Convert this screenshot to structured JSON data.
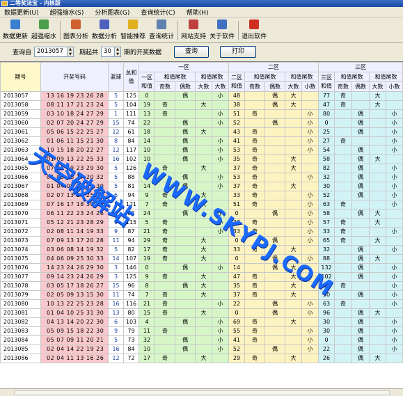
{
  "window": {
    "title": "二等奖法宝 - 内核版"
  },
  "menu": [
    "数据更新(U)",
    "超强缩水(S)",
    "分析图表(G)",
    "查询统计(C)",
    "帮助(H)"
  ],
  "toolbar": [
    {
      "label": "数据更新",
      "icon": "refresh-icon",
      "color": "#3a7fd0"
    },
    {
      "label": "超强缩水",
      "icon": "shrink-icon",
      "color": "#4aa04a"
    },
    {
      "label": "图表分析",
      "icon": "chart-icon",
      "color": "#d06030"
    },
    {
      "label": "数据分析",
      "icon": "gear-icon",
      "color": "#5060c0"
    },
    {
      "label": "智能推荐",
      "icon": "bulb-icon",
      "color": "#e0b020"
    },
    {
      "label": "查询统计",
      "icon": "search-icon",
      "color": "#6080b0"
    },
    {
      "label": "网站支持",
      "icon": "home-icon",
      "color": "#c04040"
    },
    {
      "label": "关于软件",
      "icon": "info-icon",
      "color": "#4070c0"
    },
    {
      "label": "退出软件",
      "icon": "exit-icon",
      "color": "#d03020"
    }
  ],
  "query": {
    "issue_label": "查询自",
    "issue_value": "2013057",
    "period_label": "期起共",
    "period_value": "30",
    "period_suffix": "期的开奖数据",
    "query_button": "查询",
    "print_button": "打印"
  },
  "table": {
    "head_issue": "期号",
    "head_numbers": "开奖号码",
    "head_blue": "蓝球",
    "head_total": "总和值",
    "zone1": "一区",
    "zone2": "二区",
    "zone3": "三区",
    "z1_sum": "一区和值",
    "z2_sum": "二区和值",
    "z3_sum": "三区和值",
    "tail_sum": "和值尾数",
    "tail_sum_parity": "和值尾数",
    "tail_sum_size": "和值尾数",
    "odd": "奇数",
    "even": "偶数",
    "big": "大数",
    "small": "小数",
    "rows": [
      [
        "2013057",
        "13 16 19 23 26 28",
        "5",
        "125",
        "0",
        "",
        "偶",
        "",
        "小",
        "48",
        "",
        "偶",
        "大",
        "",
        "77",
        "奇",
        "",
        "大",
        ""
      ],
      [
        "2013058",
        "08 11 17 21 23 24",
        "5",
        "104",
        "19",
        "奇",
        "",
        "大",
        "",
        "38",
        "",
        "偶",
        "大",
        "",
        "47",
        "奇",
        "",
        "大",
        ""
      ],
      [
        "2013059",
        "03 10 18 24 27 29",
        "1",
        "111",
        "13",
        "奇",
        "",
        "",
        "小",
        "51",
        "奇",
        "",
        "",
        "小",
        "80",
        "",
        "偶",
        "",
        "小"
      ],
      [
        "2013060",
        "02 07 20 24 27 29",
        "15",
        "74",
        "22",
        "",
        "偶",
        "",
        "小",
        "52",
        "",
        "偶",
        "",
        "小",
        "0",
        "",
        "偶",
        "",
        "小"
      ],
      [
        "2013061",
        "05 06 15 22 25 27",
        "12",
        "61",
        "18",
        "",
        "偶",
        "大",
        "",
        "43",
        "奇",
        "",
        "",
        "小",
        "25",
        "",
        "偶",
        "",
        "小"
      ],
      [
        "2013062",
        "01 06 11 15 21 30",
        "8",
        "84",
        "14",
        "",
        "偶",
        "",
        "小",
        "41",
        "奇",
        "",
        "",
        "小",
        "27",
        "奇",
        "",
        "",
        "小"
      ],
      [
        "2013063",
        "10 15 18 20 22 27",
        "12",
        "117",
        "10",
        "",
        "偶",
        "",
        "小",
        "53",
        "奇",
        "",
        "",
        "小",
        "54",
        "",
        "偶",
        "",
        "小"
      ],
      [
        "2013064",
        "01 09 13 22 25 33",
        "16",
        "102",
        "10",
        "",
        "偶",
        "",
        "小",
        "35",
        "奇",
        "",
        "大",
        "",
        "58",
        "",
        "偶",
        "大",
        ""
      ],
      [
        "2013065",
        "07 18 19 23 29 30",
        "5",
        "126",
        "7",
        "奇",
        "",
        "大",
        "",
        "37",
        "奇",
        "",
        "大",
        "",
        "82",
        "",
        "偶",
        "",
        "小"
      ],
      [
        "2013066",
        "01 03 16 17 20 32",
        "5",
        "88",
        "4",
        "",
        "偶",
        "",
        "小",
        "53",
        "奇",
        "",
        "",
        "小",
        "32",
        "",
        "偶",
        "",
        "小"
      ],
      [
        "2013067",
        "01 04 09 15 22 30",
        "5",
        "81",
        "14",
        "",
        "偶",
        "",
        "小",
        "37",
        "奇",
        "",
        "大",
        "",
        "30",
        "",
        "偶",
        "",
        "小"
      ],
      [
        "2013068",
        "02 07 13 20 25 27",
        "6",
        "94",
        "9",
        "奇",
        "",
        "大",
        "",
        "33",
        "奇",
        "",
        "",
        "小",
        "52",
        "",
        "偶",
        "",
        "小"
      ],
      [
        "2013069",
        "07 16 17 18 30 33",
        "5",
        "121",
        "7",
        "奇",
        "",
        "大",
        "",
        "51",
        "奇",
        "",
        "",
        "小",
        "63",
        "奇",
        "",
        "",
        "小"
      ],
      [
        "2013070",
        "06 11 22 23 24 26",
        "6",
        "82",
        "24",
        "",
        "偶",
        "",
        "小",
        "0",
        "",
        "偶",
        "",
        "小",
        "58",
        "",
        "偶",
        "大",
        ""
      ],
      [
        "2013071",
        "05 12 21 23 28 29",
        "9",
        "115",
        "5",
        "奇",
        "",
        "",
        "小",
        "33",
        "奇",
        "",
        "",
        "小",
        "57",
        "奇",
        "",
        "大",
        ""
      ],
      [
        "2013072",
        "02 08 11 14 19 33",
        "9",
        "87",
        "21",
        "奇",
        "",
        "",
        "小",
        "33",
        "奇",
        "",
        "",
        "小",
        "33",
        "奇",
        "",
        "",
        "小"
      ],
      [
        "2013073",
        "07 09 13 17 20 28",
        "11",
        "94",
        "29",
        "奇",
        "",
        "大",
        "",
        "0",
        "",
        "偶",
        "",
        "小",
        "65",
        "奇",
        "",
        "大",
        ""
      ],
      [
        "2013074",
        "03 06 08 14 19 32",
        "5",
        "82",
        "17",
        "奇",
        "",
        "大",
        "",
        "33",
        "奇",
        "",
        "大",
        "",
        "32",
        "",
        "偶",
        "",
        "小"
      ],
      [
        "2013075",
        "04 06 09 25 30 33",
        "14",
        "107",
        "19",
        "奇",
        "",
        "大",
        "",
        "0",
        "",
        "偶",
        "",
        "小",
        "88",
        "",
        "偶",
        "大",
        ""
      ],
      [
        "2013076",
        "14 23 24 26 29 30",
        "3",
        "146",
        "0",
        "",
        "偶",
        "",
        "小",
        "14",
        "",
        "偶",
        "大",
        "",
        "132",
        "",
        "偶",
        "",
        "小"
      ],
      [
        "2013077",
        "09 14 23 24 26 29",
        "3",
        "125",
        "9",
        "奇",
        "",
        "大",
        "",
        "47",
        "奇",
        "",
        "大",
        "",
        "102",
        "",
        "偶",
        "",
        "小"
      ],
      [
        "2013078",
        "03 05 17 18 26 27",
        "15",
        "96",
        "8",
        "",
        "偶",
        "大",
        "",
        "35",
        "奇",
        "",
        "大",
        "",
        "53",
        "奇",
        "",
        "",
        "小"
      ],
      [
        "2013079",
        "02 05 09 13 15 30",
        "11",
        "74",
        "7",
        "奇",
        "",
        "大",
        "",
        "37",
        "奇",
        "",
        "大",
        "",
        "30",
        "",
        "偶",
        "",
        "小"
      ],
      [
        "2013080",
        "10 13 22 25 23 28",
        "16",
        "116",
        "21",
        "奇",
        "",
        "",
        "小",
        "22",
        "",
        "偶",
        "",
        "小",
        "63",
        "奇",
        "",
        "",
        "小"
      ],
      [
        "2013081",
        "01 04 10 25 31 30",
        "13",
        "80",
        "15",
        "奇",
        "",
        "大",
        "",
        "0",
        "",
        "偶",
        "",
        "小",
        "96",
        "",
        "偶",
        "大",
        ""
      ],
      [
        "2013082",
        "04 13 14 20 22 30",
        "6",
        "103",
        "4",
        "",
        "偶",
        "",
        "小",
        "69",
        "奇",
        "",
        "大",
        "",
        "30",
        "",
        "偶",
        "",
        "小"
      ],
      [
        "2013083",
        "05 09 15 18 22 30",
        "9",
        "79",
        "11",
        "奇",
        "",
        "",
        "小",
        "55",
        "奇",
        "",
        "",
        "小",
        "30",
        "",
        "偶",
        "",
        "小"
      ],
      [
        "2013084",
        "05 07 09 11 20 21",
        "5",
        "73",
        "32",
        "",
        "偶",
        "",
        "小",
        "41",
        "奇",
        "",
        "",
        "小",
        "0",
        "",
        "偶",
        "",
        "小"
      ],
      [
        "2013085",
        "02 04 14 22 19 23",
        "16",
        "84",
        "10",
        "",
        "偶",
        "",
        "小",
        "52",
        "",
        "偶",
        "",
        "小",
        "22",
        "",
        "偶",
        "",
        "小"
      ],
      [
        "2013086",
        "02 04 11 13 16 26",
        "12",
        "72",
        "17",
        "奇",
        "",
        "大",
        "",
        "29",
        "奇",
        "",
        "大",
        "",
        "26",
        "",
        "偶",
        "大",
        ""
      ]
    ]
  },
  "watermark": {
    "line1": "天空破解站",
    "line2": "WWW.SKYPJ.COM"
  }
}
